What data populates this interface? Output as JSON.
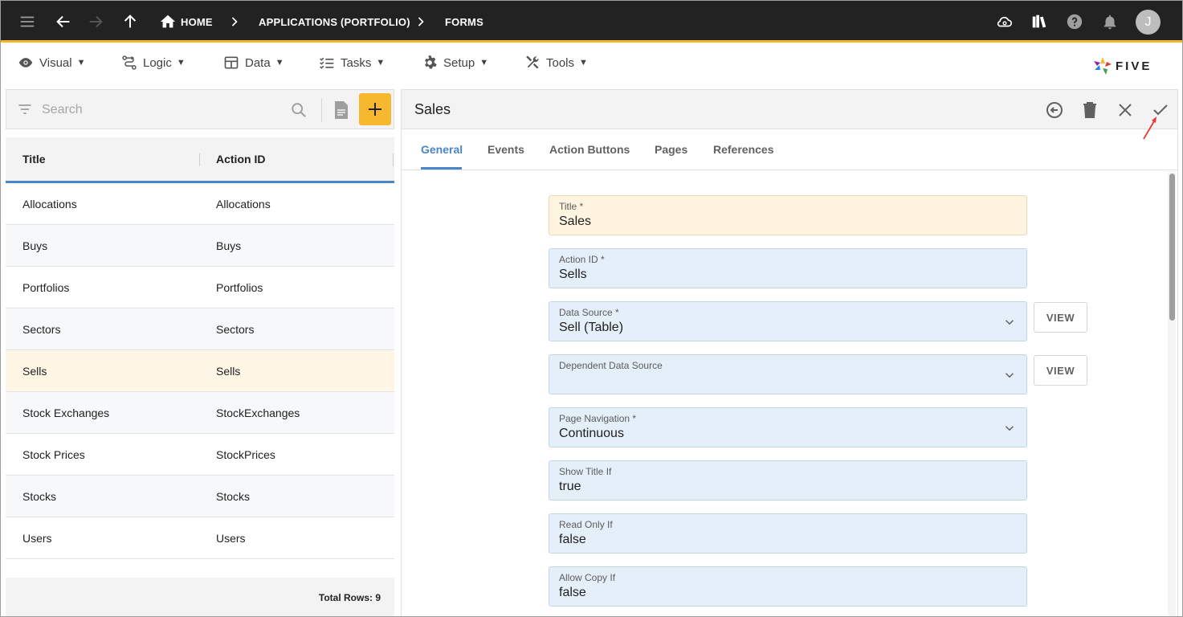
{
  "topbar": {
    "breadcrumb": {
      "home": "HOME",
      "app": "APPLICATIONS (PORTFOLIO)",
      "forms": "FORMS"
    },
    "avatar_initial": "J",
    "accent_color": "#f5b82e"
  },
  "menu": {
    "visual": "Visual",
    "logic": "Logic",
    "data": "Data",
    "tasks": "Tasks",
    "setup": "Setup",
    "tools": "Tools",
    "logo_text": "FIVE"
  },
  "list": {
    "search_placeholder": "Search",
    "columns": {
      "title": "Title",
      "action_id": "Action ID"
    },
    "rows": [
      {
        "title": "Allocations",
        "action_id": "Allocations"
      },
      {
        "title": "Buys",
        "action_id": "Buys"
      },
      {
        "title": "Portfolios",
        "action_id": "Portfolios"
      },
      {
        "title": "Sectors",
        "action_id": "Sectors"
      },
      {
        "title": "Sells",
        "action_id": "Sells"
      },
      {
        "title": "Stock Exchanges",
        "action_id": "StockExchanges"
      },
      {
        "title": "Stock Prices",
        "action_id": "StockPrices"
      },
      {
        "title": "Stocks",
        "action_id": "Stocks"
      },
      {
        "title": "Users",
        "action_id": "Users"
      }
    ],
    "selected_index": 4,
    "total_rows": "Total Rows: 9"
  },
  "detail": {
    "title": "Sales",
    "tabs": [
      "General",
      "Events",
      "Action Buttons",
      "Pages",
      "References"
    ],
    "active_tab": "General",
    "view_label": "VIEW",
    "fields": [
      {
        "label": "Title *",
        "value": "Sales"
      },
      {
        "label": "Action ID *",
        "value": "Sells"
      },
      {
        "label": "Data Source *",
        "value": "Sell (Table)"
      },
      {
        "label": "Dependent Data Source",
        "value": ""
      },
      {
        "label": "Page Navigation *",
        "value": "Continuous"
      },
      {
        "label": "Show Title If",
        "value": "true"
      },
      {
        "label": "Read Only If",
        "value": "false"
      },
      {
        "label": "Allow Copy If",
        "value": "false"
      }
    ]
  }
}
